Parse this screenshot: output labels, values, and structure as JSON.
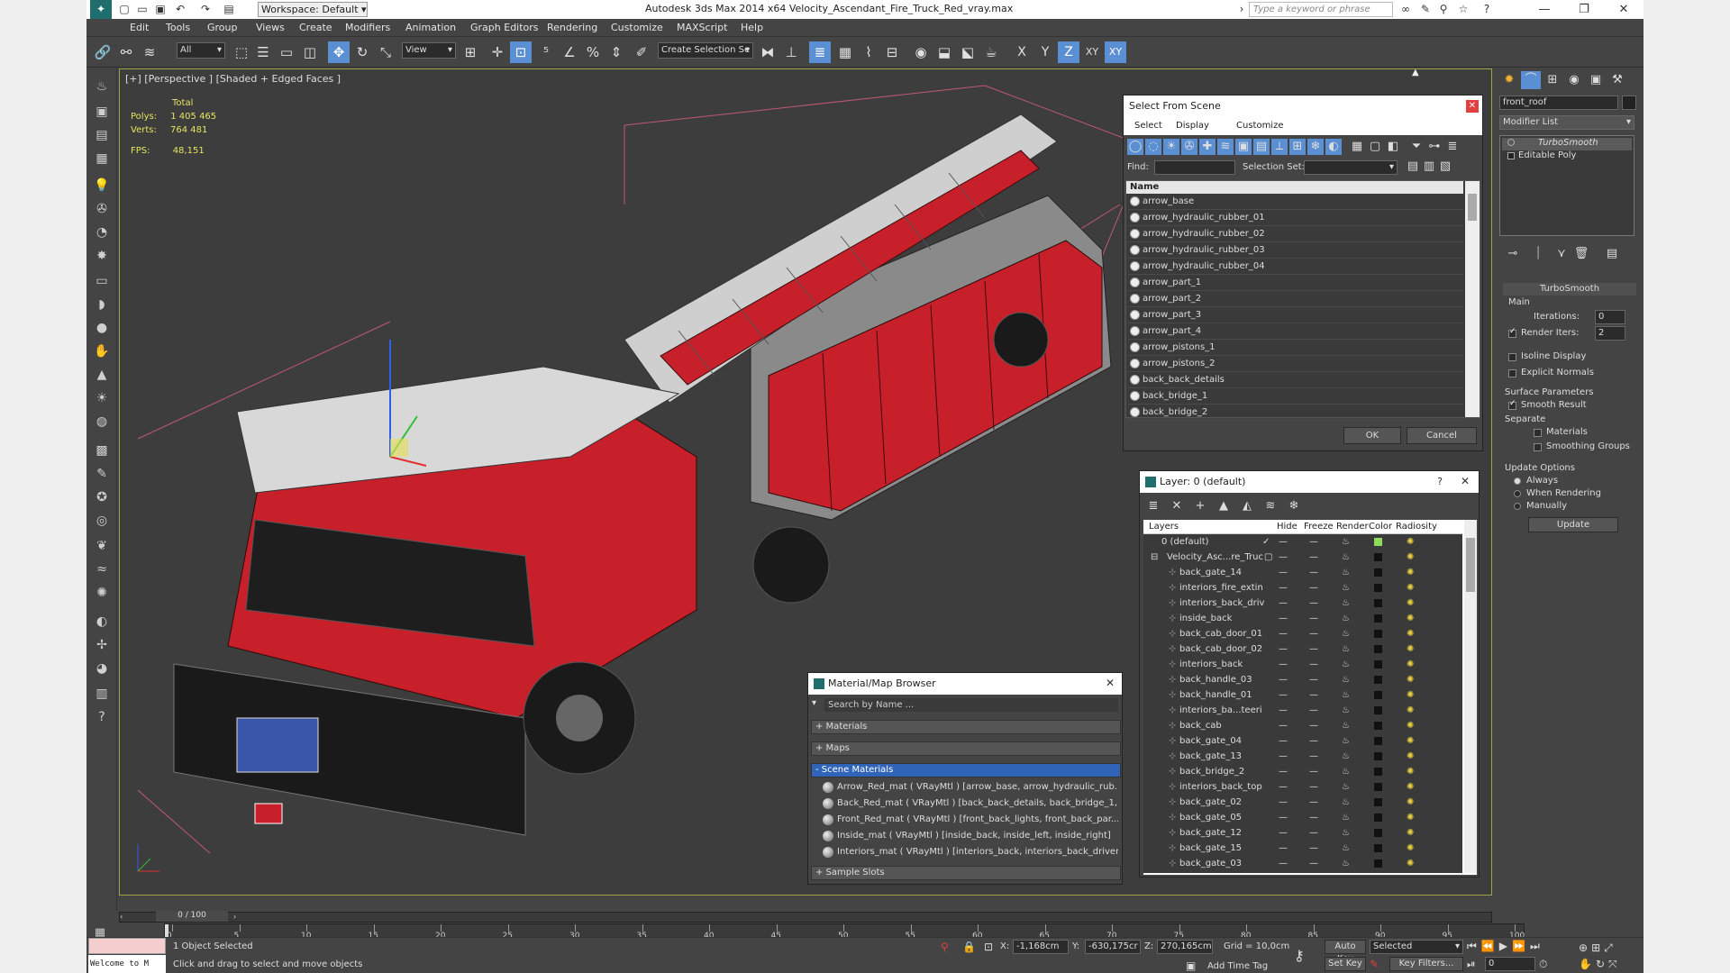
{
  "title_bar": {
    "workspace": "Workspace: Default",
    "title": "Autodesk 3ds Max  2014 x64     Velocity_Ascendant_Fire_Truck_Red_vray.max",
    "search_placeholder": "Type a keyword or phrase"
  },
  "menu": [
    "Edit",
    "Tools",
    "Group",
    "Views",
    "Create",
    "Modifiers",
    "Animation",
    "Graph Editors",
    "Rendering",
    "Customize",
    "MAXScript",
    "Help"
  ],
  "toolbar": {
    "filter": "All",
    "ref_coord": "View",
    "selection_set": "Create Selection Se",
    "axis_x": "X",
    "axis_y": "Y",
    "axis_z": "Z",
    "axis_xy": "XY",
    "axis_xy2": "XY"
  },
  "viewport": {
    "label": "[+] [Perspective ] [Shaded + Edged Faces ]",
    "stats_total": "Total",
    "polys_label": "Polys:",
    "polys": "1 405 465",
    "verts_label": "Verts:",
    "verts": "764 481",
    "fps_label": "FPS:",
    "fps": "48,151"
  },
  "modify_panel": {
    "object_name": "front_roof",
    "modifier_list": "Modifier List",
    "stack": [
      "TurboSmooth",
      "Editable Poly"
    ],
    "turbosmooth_title": "TurboSmooth",
    "main": "Main",
    "iterations_label": "Iterations:",
    "iterations": "0",
    "render_iters_label": "Render Iters:",
    "render_iters": "2",
    "isoline": "Isoline Display",
    "explicit_normals": "Explicit Normals",
    "surface_params": "Surface Parameters",
    "smooth_result": "Smooth Result",
    "separate": "Separate",
    "materials": "Materials",
    "smoothing_groups": "Smoothing Groups",
    "update_options": "Update Options",
    "always": "Always",
    "when_rendering": "When Rendering",
    "manually": "Manually",
    "update_btn": "Update"
  },
  "select_dialog": {
    "title": "Select From Scene",
    "menus": [
      "Select",
      "Display",
      "Customize"
    ],
    "find_label": "Find:",
    "selection_set_label": "Selection Set:",
    "column_name": "Name",
    "items": [
      "arrow_base",
      "arrow_hydraulic_rubber_01",
      "arrow_hydraulic_rubber_02",
      "arrow_hydraulic_rubber_03",
      "arrow_hydraulic_rubber_04",
      "arrow_part_1",
      "arrow_part_2",
      "arrow_part_3",
      "arrow_part_4",
      "arrow_pistons_1",
      "arrow_pistons_2",
      "back_back_details",
      "back_bridge_1",
      "back_bridge_2"
    ],
    "ok": "OK",
    "cancel": "Cancel"
  },
  "layer_dialog": {
    "title": "Layer: 0 (default)",
    "help": "?",
    "columns": [
      "Layers",
      "Hide",
      "Freeze",
      "Render",
      "Color",
      "Radiosity"
    ],
    "default_layer": "0 (default)",
    "parent": "Velocity_Asc...re_Truc",
    "items": [
      "back_gate_14",
      "interiors_fire_extin",
      "interiors_back_driv",
      "inside_back",
      "back_cab_door_01",
      "back_cab_door_02",
      "interiors_back",
      "back_handle_03",
      "back_handle_01",
      "interiors_ba...teeri",
      "back_cab",
      "back_gate_04",
      "back_gate_13",
      "back_bridge_2",
      "interiors_back_top",
      "back_gate_02",
      "back_gate_05",
      "back_gate_12",
      "back_gate_15",
      "back_gate_03"
    ],
    "color_default": "#8ddb5a",
    "color_item": "#111111"
  },
  "material_browser": {
    "title": "Material/Map Browser",
    "search_placeholder": "Search by Name ...",
    "sections": [
      "+ Materials",
      "+ Maps",
      "- Scene Materials",
      "+ Sample Slots"
    ],
    "materials": [
      "Arrow_Red_mat ( VRayMtl ) [arrow_base, arrow_hydraulic_rub...",
      "Back_Red_mat ( VRayMtl ) [back_back_details, back_bridge_1,...",
      "Front_Red_mat ( VRayMtl ) [front_back_lights, front_back_par...",
      "Inside_mat ( VRayMtl ) [inside_back, inside_left, inside_right]",
      "Interiors_mat ( VRayMtl ) [interiors_back, interiors_back_driver..."
    ]
  },
  "timeline": {
    "frame": "0 / 100",
    "ticks": [
      "0",
      "5",
      "10",
      "15",
      "20",
      "25",
      "30",
      "35",
      "40",
      "45",
      "50",
      "55",
      "60",
      "65",
      "70",
      "75",
      "80",
      "85",
      "90",
      "95",
      "100"
    ]
  },
  "status": {
    "maxscript": "Welcome to M",
    "selected": "1 Object Selected",
    "prompt": "Click and drag to select and move objects",
    "x_label": "X:",
    "x": "-1,168cm",
    "y_label": "Y:",
    "y": "-630,175cr",
    "z_label": "Z:",
    "z": "270,165cm",
    "grid": "Grid = 10,0cm",
    "add_time_tag": "Add Time Tag",
    "auto_key": "Auto Key",
    "set_key": "Set Key",
    "key_mode": "Selected",
    "key_filters": "Key Filters...",
    "current_frame": "0"
  },
  "colors": {
    "accent": "#5b8fd3",
    "viewport_border": "#a0a046",
    "truck_red": "#c8202a"
  }
}
